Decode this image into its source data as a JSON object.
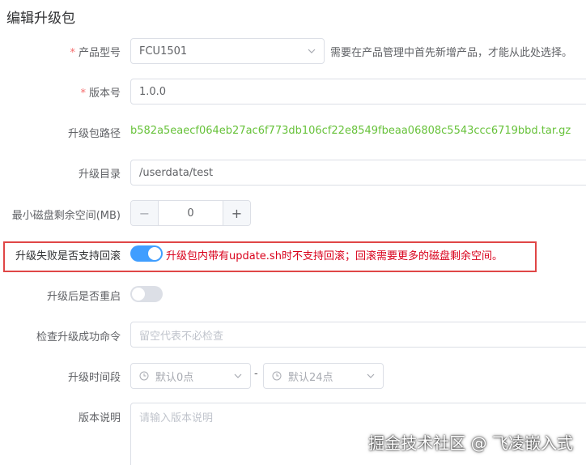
{
  "page": {
    "title": "编辑升级包"
  },
  "form": {
    "product_model": {
      "label": "产品型号",
      "value": "FCU1501",
      "hint": "需要在产品管理中首先新增产品，才能从此处选择。"
    },
    "version": {
      "label": "版本号",
      "value": "1.0.0"
    },
    "package_path": {
      "label": "升级包路径",
      "value": "b582a5eaecf064eb27ac6f773db106cf22e8549fbeaa06808c5543ccc6719bbd.tar.gz"
    },
    "upgrade_dir": {
      "label": "升级目录",
      "value": "/userdata/test"
    },
    "min_disk": {
      "label": "最小磁盘剩余空间(MB)",
      "value": "0",
      "minus": "−",
      "plus": "+"
    },
    "rollback": {
      "label": "升级失败是否支持回滚",
      "enabled": true,
      "warning": "升级包内带有update.sh时不支持回滚；回滚需要更多的磁盘剩余空间。"
    },
    "reboot": {
      "label": "升级后是否重启",
      "enabled": false
    },
    "check_cmd": {
      "label": "检查升级成功命令",
      "placeholder": "留空代表不必检查"
    },
    "time_range": {
      "label": "升级时间段",
      "start_placeholder": "默认0点",
      "separator": "-",
      "end_placeholder": "默认24点"
    },
    "description": {
      "label": "版本说明",
      "placeholder": "请输入版本说明"
    },
    "required_mark": "*"
  },
  "watermark": "掘金技术社区 @ 飞凌嵌入式",
  "colors": {
    "primary": "#409eff",
    "success_text": "#67c23a",
    "danger": "#e04646",
    "required": "#f56c6c"
  }
}
